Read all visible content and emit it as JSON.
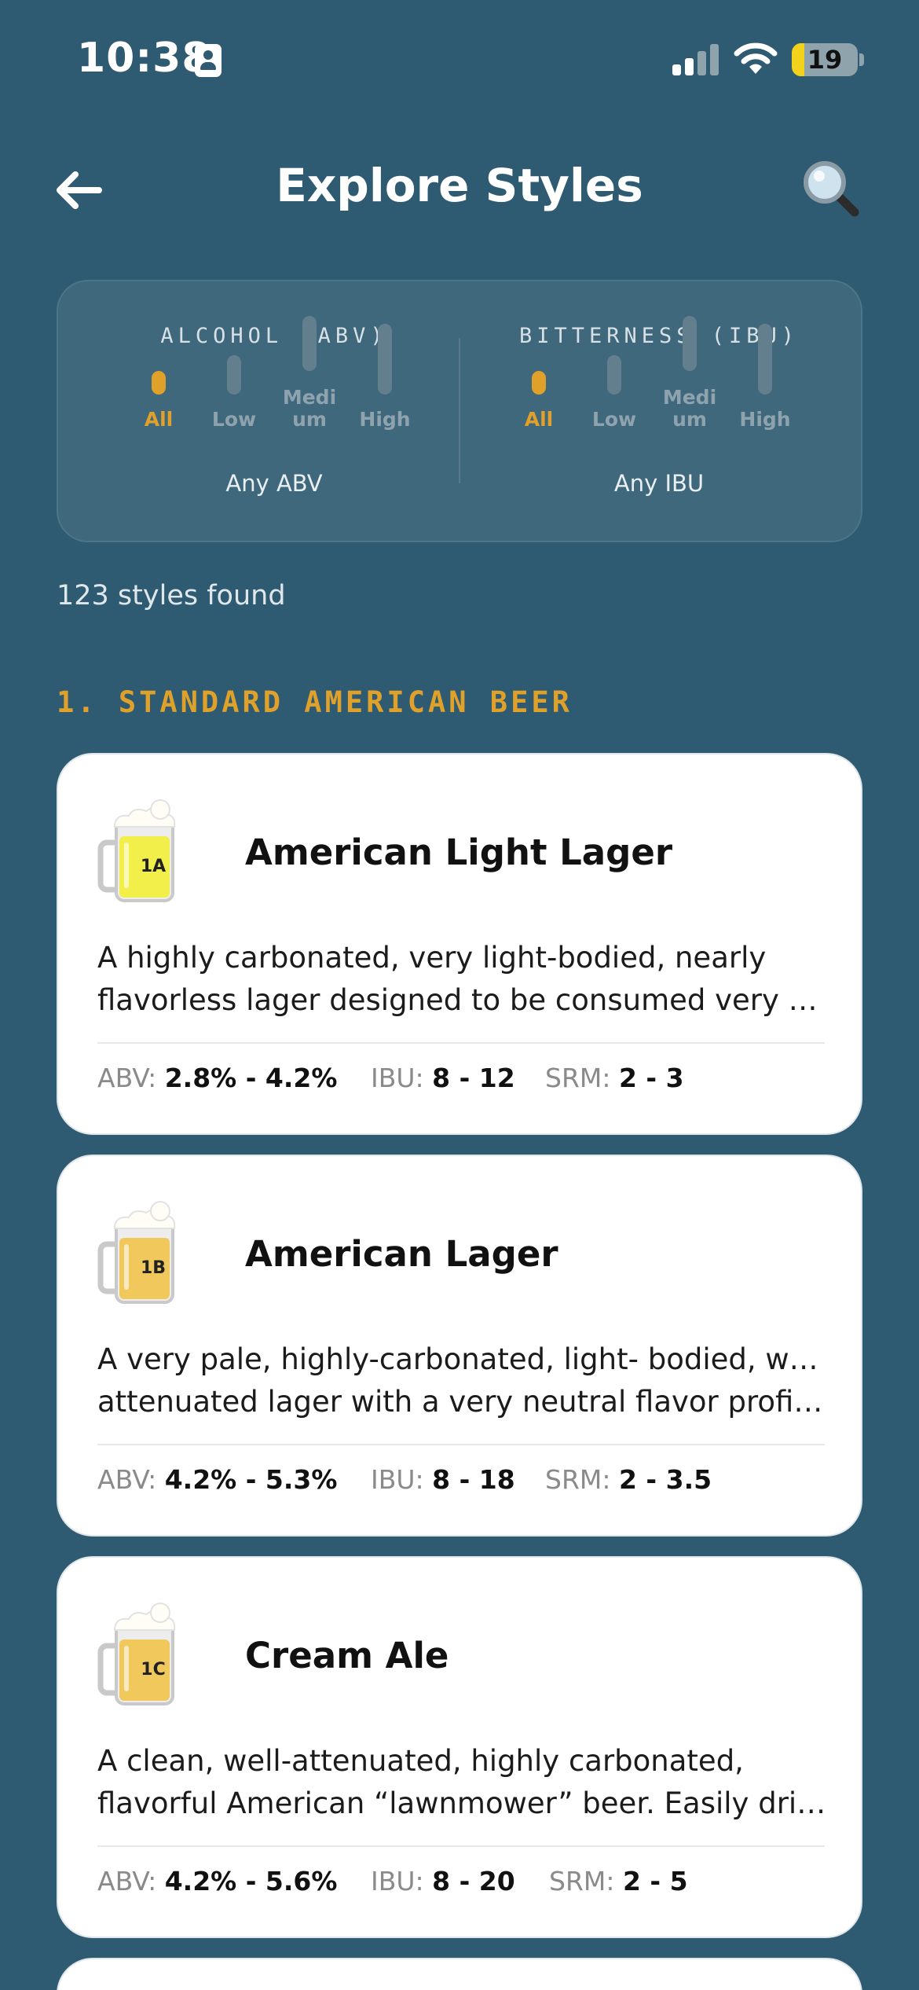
{
  "status_bar": {
    "time": "10:38",
    "battery": "19",
    "battery_level": 0.19,
    "icons": [
      "id-card-icon",
      "cellular-signal-icon",
      "wifi-icon",
      "battery-icon"
    ]
  },
  "nav": {
    "title": "Explore Styles",
    "back_icon": "arrow-left-icon",
    "search_icon": "magnifier-icon"
  },
  "filters": {
    "abv": {
      "heading": "ALCOHOL (ABV)",
      "options": [
        {
          "label": "All",
          "active": true
        },
        {
          "label": "Low",
          "active": false
        },
        {
          "label": "Medi um",
          "line1": "Medi",
          "line2": "um",
          "active": false
        },
        {
          "label": "High",
          "active": false
        }
      ],
      "value": "Any ABV"
    },
    "ibu": {
      "heading": "BITTERNESS (IBU)",
      "options": [
        {
          "label": "All",
          "active": true
        },
        {
          "label": "Low",
          "active": false
        },
        {
          "label": "Medi um",
          "line1": "Medi",
          "line2": "um",
          "active": false
        },
        {
          "label": "High",
          "active": false
        }
      ],
      "value": "Any IBU"
    }
  },
  "results": {
    "count_text": "123 styles found"
  },
  "section": {
    "heading": "1. STANDARD AMERICAN BEER"
  },
  "styles": [
    {
      "code": "1A",
      "name": "American Light Lager",
      "desc_line1": "A highly carbonated, very light-bodied, nearly",
      "desc_line2": "flavorless lager designed to be consumed very c...",
      "abv_label": "ABV:",
      "abv": "2.8% - 4.2%",
      "ibu_label": "IBU:",
      "ibu": "8 - 12",
      "srm_label": "SRM:",
      "srm": "2 - 3",
      "beer_color": "#f2ef4a"
    },
    {
      "code": "1B",
      "name": "American Lager",
      "desc_line1": "A very pale, highly-carbonated, light- bodied, well-",
      "desc_line2": "attenuated lager with a very neutral flavor profile...",
      "abv_label": "ABV:",
      "abv": "4.2% - 5.3%",
      "ibu_label": "IBU:",
      "ibu": "8 - 18",
      "srm_label": "SRM:",
      "srm": "2 - 3.5",
      "beer_color": "#f1c85c"
    },
    {
      "code": "1C",
      "name": "Cream Ale",
      "desc_line1": "A clean, well-attenuated, highly carbonated,",
      "desc_line2": "flavorful American “lawnmower” beer. Easily drin...",
      "abv_label": "ABV:",
      "abv": "4.2% - 5.6%",
      "ibu_label": "IBU:",
      "ibu": "8 - 20",
      "srm_label": "SRM:",
      "srm": "2 - 5",
      "beer_color": "#f1c85c"
    }
  ],
  "colors": {
    "background": "#2e5b72",
    "accent": "#e0a12a",
    "card": "#ffffff"
  }
}
